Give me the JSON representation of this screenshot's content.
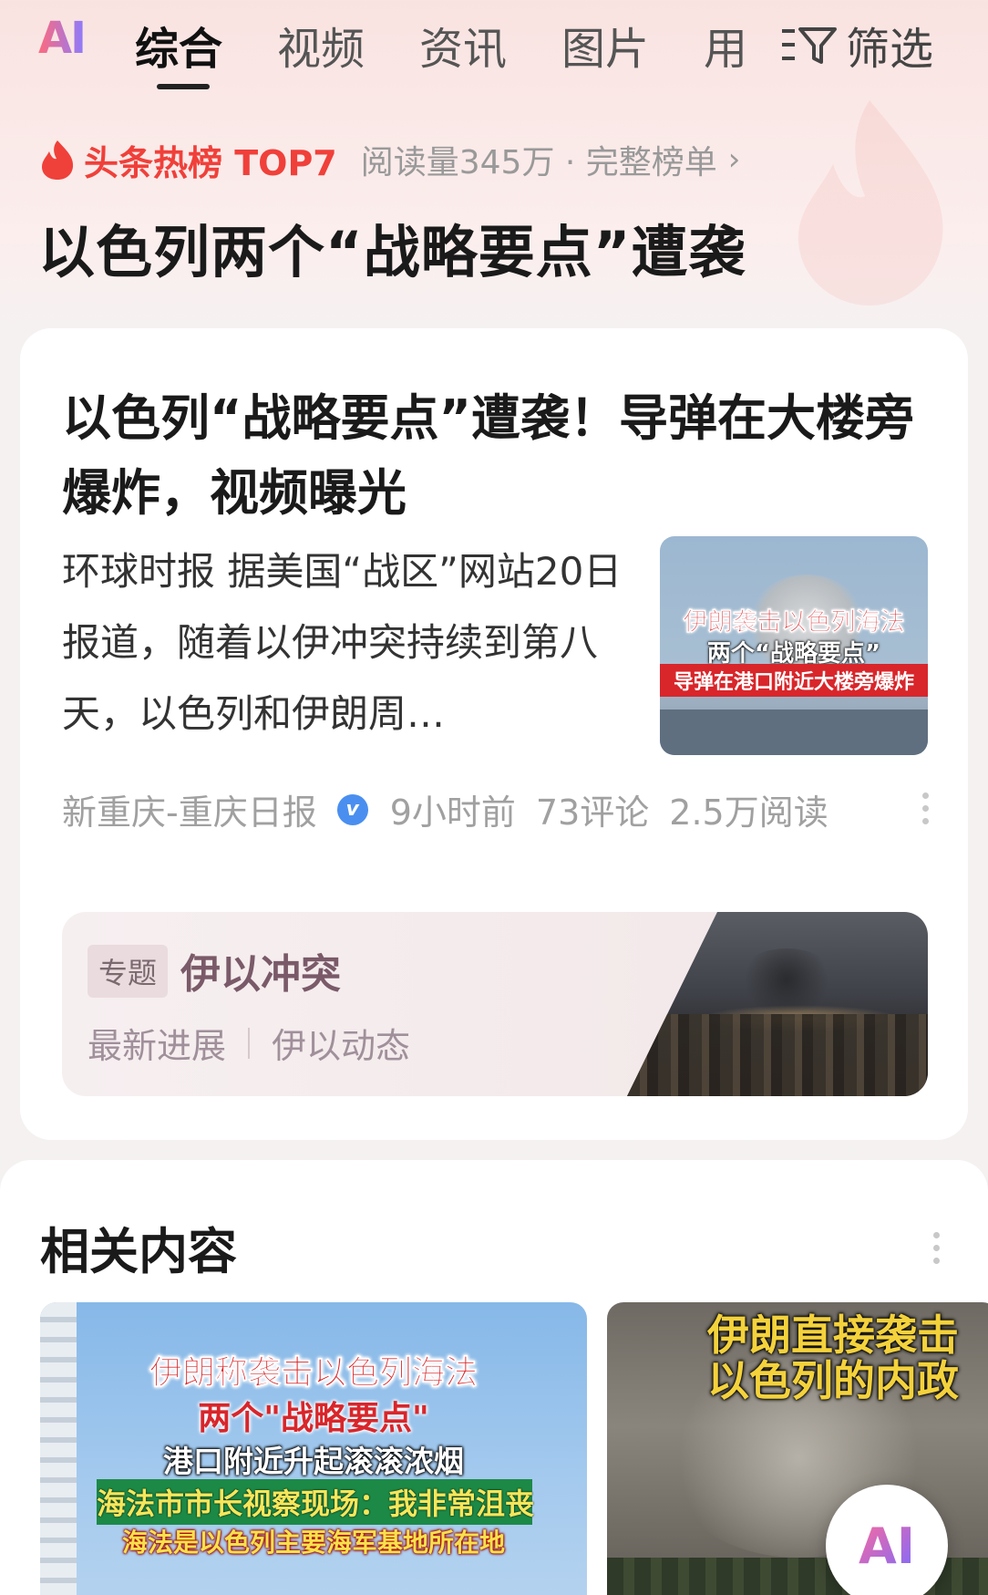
{
  "tabs": {
    "ai_label": "AI",
    "items": [
      "综合",
      "视频",
      "资讯",
      "图片",
      "用"
    ],
    "active_index": 0,
    "filter_label": "筛选"
  },
  "hot": {
    "title": "头条热榜 TOP7",
    "meta": "阅读量345万 · 完整榜单",
    "chevron": "›",
    "headline": "以色列两个“战略要点”遭袭"
  },
  "article": {
    "title": "以色列“战略要点”遭袭！导弹在大楼旁爆炸，视频曝光",
    "excerpt": "环球时报 据美国“战区”网站20日报道，随着以伊冲突持续到第八天，以色列和伊朗周…",
    "thumb_caption_1": "伊朗袭击以色列海法",
    "thumb_caption_2": "两个“战略要点”",
    "thumb_caption_3": "导弹在港口附近大楼旁爆炸",
    "source": "新重庆-重庆日报",
    "verified_mark": "v",
    "time": "9小时前",
    "comments": "73评论",
    "reads": "2.5万阅读"
  },
  "topic": {
    "tag": "专题",
    "title": "伊以冲突",
    "link_1": "最新进展",
    "link_2": "伊以动态"
  },
  "related": {
    "title": "相关内容",
    "card1": {
      "line1": "伊朗称袭击以色列海法",
      "line2": "两个\"战略要点\"",
      "line3": "港口附近升起滚滚浓烟",
      "line4": "海法市市长视察现场：我非常沮丧",
      "line5": "海法是以色列主要海军基地所在地"
    },
    "card2": {
      "line1": "伊朗直接袭击",
      "line2": "以色列的内政"
    }
  },
  "fab": {
    "label": "AI"
  },
  "colors": {
    "hot_red": "#f0403a",
    "accent_blue": "#4a8ff0",
    "topic_text": "#7a5a68"
  }
}
